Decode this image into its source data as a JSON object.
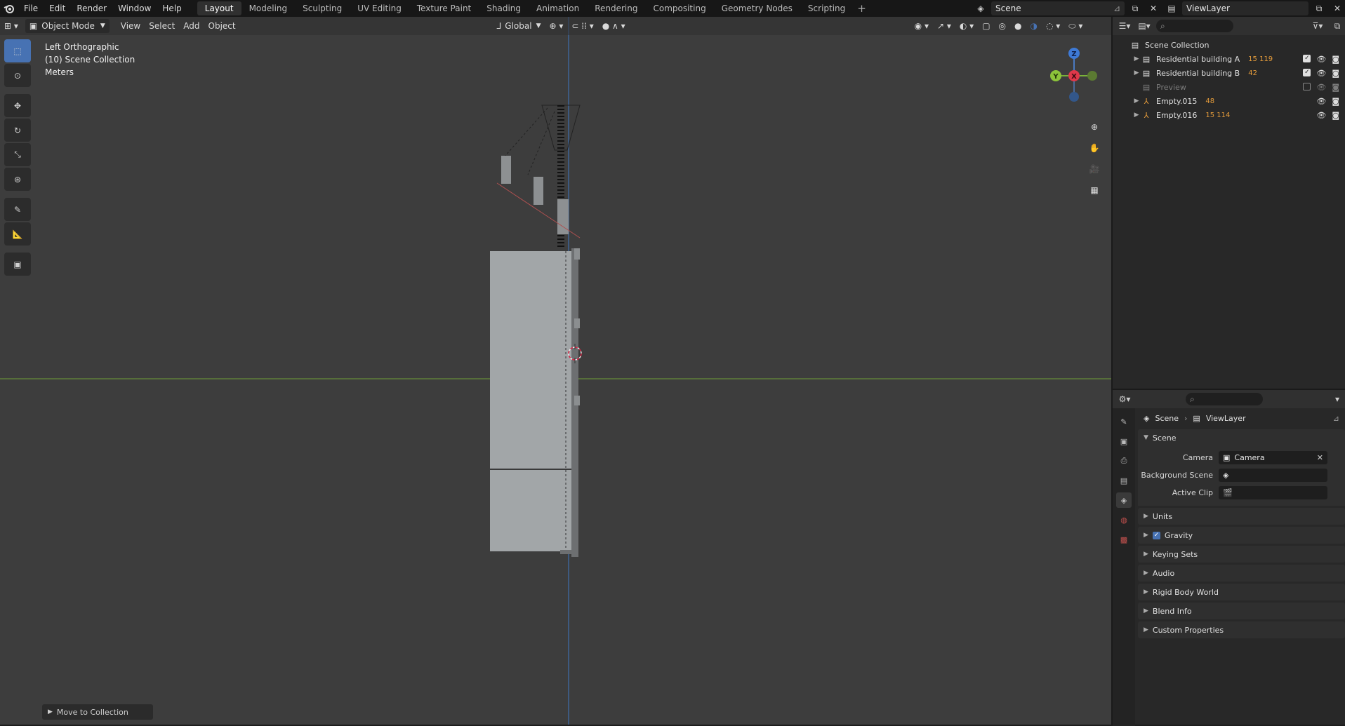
{
  "menu": [
    "File",
    "Edit",
    "Render",
    "Window",
    "Help"
  ],
  "workspaces": [
    {
      "label": "Layout",
      "active": true
    },
    {
      "label": "Modeling"
    },
    {
      "label": "Sculpting"
    },
    {
      "label": "UV Editing"
    },
    {
      "label": "Texture Paint"
    },
    {
      "label": "Shading"
    },
    {
      "label": "Animation"
    },
    {
      "label": "Rendering"
    },
    {
      "label": "Compositing"
    },
    {
      "label": "Geometry Nodes"
    },
    {
      "label": "Scripting"
    }
  ],
  "topbar": {
    "scene": "Scene",
    "view_layer": "ViewLayer",
    "add_label": "+"
  },
  "viewport": {
    "mode": "Object Mode",
    "menus": [
      "View",
      "Select",
      "Add",
      "Object"
    ],
    "orientation": "Global",
    "view_name": "Left Orthographic",
    "collection": "(10) Scene Collection",
    "units": "Meters",
    "redo_panel": "Move to Collection",
    "gizmo": {
      "z": "Z",
      "y": "Y",
      "x": "X"
    }
  },
  "outliner": {
    "root": "Scene Collection",
    "rows": [
      {
        "label": "Residential building A",
        "extra": "15 119",
        "checked": true
      },
      {
        "label": "Residential building B",
        "extra": "42",
        "checked": true
      },
      {
        "label": "Preview",
        "extra": "",
        "checked": false,
        "dim": true
      },
      {
        "label": "Empty.015",
        "extra": "48",
        "checked": null
      },
      {
        "label": "Empty.016",
        "extra": "15 114",
        "checked": null
      }
    ]
  },
  "properties": {
    "breadcrumb": {
      "scene": "Scene",
      "view_layer": "ViewLayer"
    },
    "scene_panel": {
      "title": "Scene",
      "camera_label": "Camera",
      "camera_value": "Camera",
      "background_label": "Background Scene",
      "background_value": "",
      "clip_label": "Active Clip",
      "clip_value": ""
    },
    "panels": [
      "Units",
      "Gravity",
      "Keying Sets",
      "Audio",
      "Rigid Body World",
      "Blend Info",
      "Custom Properties"
    ]
  },
  "colors": {
    "accent": "#4772b3",
    "viewport_bg": "#3d3d3d",
    "axis_green": "#6a9b3a",
    "axis_blue": "#4a6a9a"
  }
}
